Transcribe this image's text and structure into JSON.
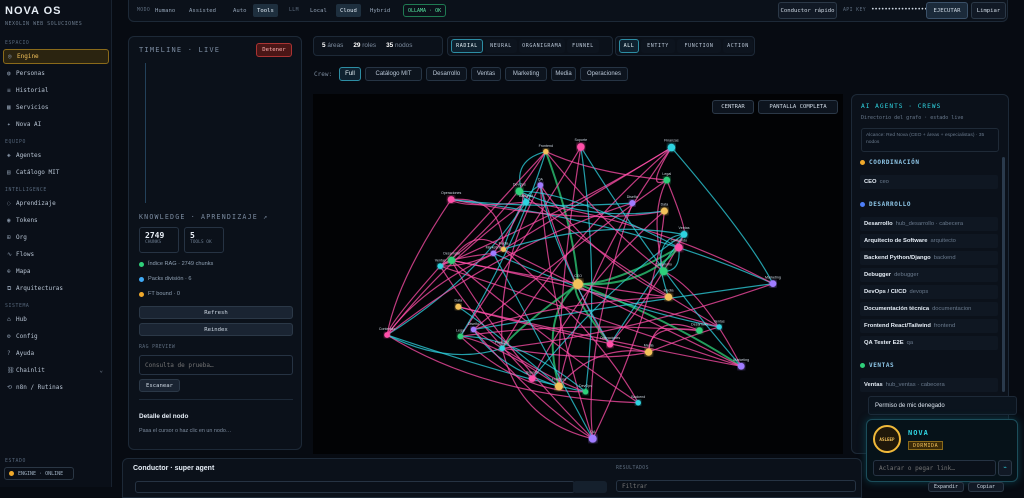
{
  "app": {
    "name": "NOVA OS",
    "tagline": "NEXOLIN WEB SOLUCIONES"
  },
  "sidebar": {
    "sections": [
      {
        "label": "ESPACIO",
        "items": [
          {
            "label": "Engine",
            "icon": "target-icon",
            "glyph": "◎",
            "active": true
          },
          {
            "label": "Personas",
            "icon": "users-icon",
            "glyph": "◍"
          },
          {
            "label": "Historial",
            "icon": "list-icon",
            "glyph": "≡"
          },
          {
            "label": "Servicios",
            "icon": "grid-icon",
            "glyph": "▦"
          },
          {
            "label": "Nova AI",
            "icon": "spark-icon",
            "glyph": "✦"
          }
        ]
      },
      {
        "label": "EQUIPO",
        "items": [
          {
            "label": "Agentes",
            "icon": "agent-icon",
            "glyph": "◈"
          },
          {
            "label": "Catálogo MIT",
            "icon": "book-icon",
            "glyph": "▤"
          }
        ]
      },
      {
        "label": "INTELLIGENCE",
        "items": [
          {
            "label": "Aprendizaje",
            "icon": "brain-icon",
            "glyph": "◌"
          },
          {
            "label": "Tokens",
            "icon": "token-icon",
            "glyph": "◉"
          },
          {
            "label": "Org",
            "icon": "org-icon",
            "glyph": "⊞"
          },
          {
            "label": "Flows",
            "icon": "flow-icon",
            "glyph": "∿"
          },
          {
            "label": "Mapa",
            "icon": "globe-icon",
            "glyph": "⊕"
          },
          {
            "label": "Arquitecturas",
            "icon": "layers-icon",
            "glyph": "⧉"
          }
        ]
      },
      {
        "label": "SISTEMA",
        "items": [
          {
            "label": "Hub",
            "icon": "hub-icon",
            "glyph": "⌂"
          },
          {
            "label": "Config",
            "icon": "gear-icon",
            "glyph": "⚙"
          },
          {
            "label": "Ayuda",
            "icon": "help-icon",
            "glyph": "?"
          },
          {
            "label": "Chainlit",
            "icon": "chain-icon",
            "glyph": "⛓",
            "chevron": "⌄"
          },
          {
            "label": "n8n / Rutinas",
            "icon": "routine-icon",
            "glyph": "⟲"
          }
        ]
      }
    ],
    "status_label": "ESTADO",
    "status": {
      "engine": "ENGINE",
      "state": "ONLINE"
    }
  },
  "topbar": {
    "mode_label": "MODO",
    "modes": [
      "Humano",
      "Assisted",
      "Auto",
      "Tools"
    ],
    "active_mode": "Tools",
    "llm_label": "LLM",
    "llm": [
      "Local",
      "Cloud",
      "Hybrid"
    ],
    "active_llm": "Cloud",
    "ollama": "OLLAMA · OK",
    "quick": "Conductor rápido",
    "api_label": "API KEY",
    "api_value": "•••••••••••••••••••••••",
    "run": "EJECUTAR",
    "clear": "Limpiar"
  },
  "timeline": {
    "title": "TIMELINE · LIVE",
    "stop": "Detener"
  },
  "knowledge": {
    "title": "KNOWLEDGE · APRENDIZAJE ↗",
    "chunks_value": "2749",
    "chunks_label": "CHUNKS",
    "tools_value": "5",
    "tools_label": "TOOLS OK",
    "lines": [
      {
        "text": "Índice RAG · 2749 chunks",
        "color": "#2fd07a"
      },
      {
        "text": "Packs división · 6",
        "color": "#3fa9f5"
      },
      {
        "text": "FT bound · 0",
        "color": "#f0a92b"
      }
    ],
    "refresh": "Refresh",
    "reindex": "Reindex",
    "rag_label": "RAG PREVIEW",
    "rag_placeholder": "Consulta de prueba…",
    "scan": "Escanear",
    "detail_title": "Detalle del nodo",
    "detail_hint": "Pasa el cursor o haz clic en un nodo…"
  },
  "stats": {
    "areas": "5",
    "areas_label": "áreas",
    "roles": "29",
    "roles_label": "roles",
    "nodes": "35",
    "nodes_label": "nodos"
  },
  "layouts": [
    "RADIAL",
    "NEURAL",
    "ORGANIGRAMA",
    "FUNNEL"
  ],
  "active_layout": "RADIAL",
  "filters": [
    "ALL",
    "ENTITY",
    "FUNCTION",
    "ACTION"
  ],
  "active_filter": "ALL",
  "crew_label": "Crew:",
  "crews": [
    "Full",
    "Catálogo MIT",
    "Desarrollo",
    "Ventas",
    "Marketing",
    "Media",
    "Operaciones"
  ],
  "active_crew": "Full",
  "graph": {
    "center": "CENTRAR",
    "fullscreen": "PANTALLA COMPLETA",
    "center_node": "CEO",
    "node_labels": [
      "Ventas",
      "Desarrollo",
      "Marketing",
      "Media",
      "Operaciones",
      "Backend",
      "DevOps",
      "QA",
      "Frontend",
      "Soporte",
      "Finanzas",
      "Legal",
      "Diseño",
      "Data",
      "Contenido"
    ]
  },
  "agents": {
    "title": "AI AGENTS · CREWS",
    "subtitle": "Directorio del grafo · estado live",
    "notice": "Alcance: Red Nova (CEO + áreas + especialistas) · 35 nodos",
    "groups": [
      {
        "name": "COORDINACIÓN",
        "color": "#f0a92b",
        "rows": [
          {
            "name": "CEO",
            "sub": "ceo"
          }
        ]
      },
      {
        "name": "DESARROLLO",
        "color": "#4d7ef7",
        "rows": [
          {
            "name": "Desarrollo",
            "sub": "hub_desarrollo · cabecera"
          },
          {
            "name": "Arquitecto de Software",
            "sub": "arquitecto"
          },
          {
            "name": "Backend Python/Django",
            "sub": "backend"
          },
          {
            "name": "Debugger",
            "sub": "debugger"
          },
          {
            "name": "DevOps / CI/CD",
            "sub": "devops"
          },
          {
            "name": "Documentación técnica",
            "sub": "documentacion"
          },
          {
            "name": "Frontend React/Tailwind",
            "sub": "frontend"
          },
          {
            "name": "QA Tester E2E",
            "sub": "qa"
          }
        ]
      },
      {
        "name": "VENTAS",
        "color": "#2fd07a",
        "rows": [
          {
            "name": "Ventas",
            "sub": "hub_ventas · cabecera"
          }
        ]
      }
    ]
  },
  "toast": "Permiso de mic denegado",
  "nova": {
    "name": "NOVA",
    "badge": "ASLEEP",
    "state": "DORMIDA",
    "placeholder": "Aclarar o pegar link…",
    "send": "⌁"
  },
  "conductor": {
    "title": "Conductor · super agent",
    "results_label": "RESULTADOS",
    "results_placeholder": "Filtrar",
    "expand": "Expandir",
    "copy": "Copiar"
  },
  "colors": {
    "accent": "#f3c25a",
    "cyan": "#2fd3e0",
    "pink": "#ff4fa8",
    "green": "#2fd07a",
    "violet": "#a07cff"
  }
}
